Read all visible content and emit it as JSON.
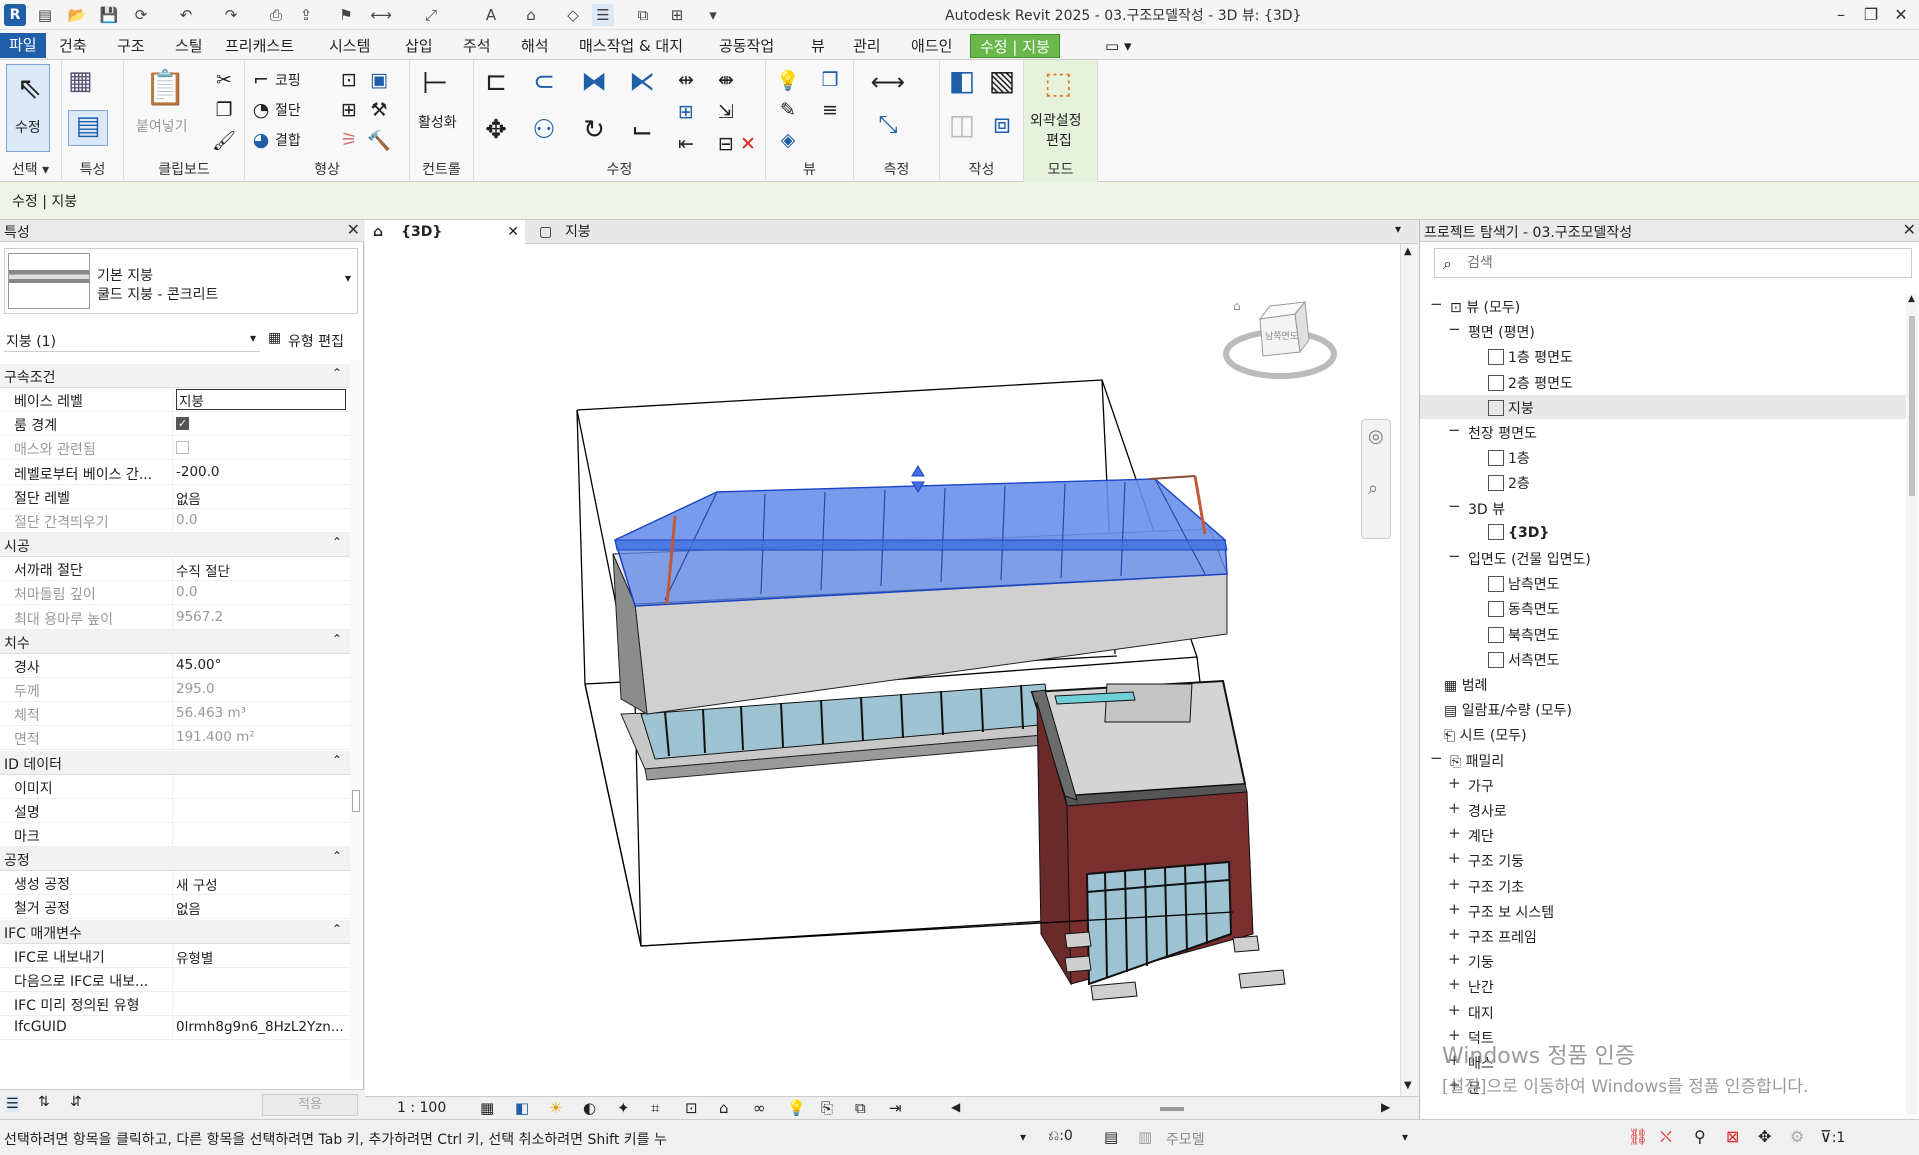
{
  "window": {
    "title": "Autodesk Revit 2025 - 03.구조모델작성 - 3D 뷰: {3D}",
    "app_badge": "R"
  },
  "menu": {
    "tabs": [
      "파일",
      "건축",
      "구조",
      "스틸",
      "프리캐스트",
      "시스템",
      "삽입",
      "주석",
      "해석",
      "매스작업 & 대지",
      "공동작업",
      "뷰",
      "관리",
      "애드인",
      "수정 | 지붕"
    ],
    "active_tab": "수정 | 지붕"
  },
  "ribbon": {
    "modify_label": "수정",
    "select_label": "선택",
    "properties_label": "특성",
    "paste_label": "붙여넣기",
    "clipboard_label": "클립보드",
    "cope_label": "코핑",
    "cut_label": "절단",
    "join_label": "결합",
    "geometry_label": "형상",
    "activate_label": "활성화",
    "controls_label": "컨트롤",
    "modify_panel_label": "수정",
    "view_label": "뷰",
    "measure_label": "측정",
    "create_label": "작성",
    "edit_footprint_line1": "외곽설정",
    "edit_footprint_line2": "편집",
    "mode_label": "모드"
  },
  "context_bar": {
    "text": "수정 | 지붕"
  },
  "properties": {
    "title": "특성",
    "type_line1": "기본 지붕",
    "type_line2": "쿨드 지붕 - 콘크리트",
    "filter": "지붕 (1)",
    "edit_type": "유형 편집",
    "apply": "적용",
    "groups": [
      {
        "name": "구속조건",
        "rows": [
          {
            "k": "베이스 레벨",
            "v": "지붕",
            "gray": false
          },
          {
            "k": "룸 경계",
            "v": "",
            "gray": false,
            "checkbox": true,
            "checked": true
          },
          {
            "k": "매스와 관련됨",
            "v": "",
            "gray": true,
            "checkbox": true,
            "checked": false
          },
          {
            "k": "레벨로부터 베이스 간...",
            "v": "-200.0",
            "gray": false
          },
          {
            "k": "절단 레벨",
            "v": "없음",
            "gray": false
          },
          {
            "k": "절단 간격띄우기",
            "v": "0.0",
            "gray": true
          }
        ]
      },
      {
        "name": "시공",
        "rows": [
          {
            "k": "서까래 절단",
            "v": "수직 절단",
            "gray": false
          },
          {
            "k": "처마돌림 깊이",
            "v": "0.0",
            "gray": true
          },
          {
            "k": "최대 용마루 높이",
            "v": "9567.2",
            "gray": true
          }
        ]
      },
      {
        "name": "치수",
        "rows": [
          {
            "k": "경사",
            "v": "45.00°",
            "gray": false
          },
          {
            "k": "두께",
            "v": "295.0",
            "gray": true
          },
          {
            "k": "체적",
            "v": "56.463 m³",
            "gray": true
          },
          {
            "k": "면적",
            "v": "191.400 m²",
            "gray": true
          }
        ]
      },
      {
        "name": "ID 데이터",
        "rows": [
          {
            "k": "이미지",
            "v": "",
            "gray": false
          },
          {
            "k": "설명",
            "v": "",
            "gray": false
          },
          {
            "k": "마크",
            "v": "",
            "gray": false
          }
        ]
      },
      {
        "name": "공정",
        "rows": [
          {
            "k": "생성 공정",
            "v": "새 구성",
            "gray": false
          },
          {
            "k": "철거 공정",
            "v": "없음",
            "gray": false
          }
        ]
      },
      {
        "name": "IFC 매개변수",
        "rows": [
          {
            "k": "IFC로 내보내기",
            "v": "유형별",
            "gray": false
          },
          {
            "k": "다음으로 IFC로 내보...",
            "v": "",
            "gray": false
          },
          {
            "k": "IFC 미리 정의된 유형",
            "v": "",
            "gray": false
          },
          {
            "k": "IfcGUID",
            "v": "0lrmh8g9n6_8HzL2Yzn...",
            "gray": false
          }
        ]
      }
    ]
  },
  "view_tabs": [
    {
      "label": "{3D}",
      "active": true
    },
    {
      "label": "지붕",
      "active": false
    }
  ],
  "viewcube": {
    "face": "남쪽면도"
  },
  "view_bar": {
    "scale": "1 : 100"
  },
  "browser": {
    "title": "프로젝트 탐색기 - 03.구조모델작성",
    "search_placeholder": "검색",
    "items": [
      {
        "label": "뷰 (모두)",
        "level": 0,
        "pm": "−"
      },
      {
        "label": "평면 (평면)",
        "level": 1,
        "pm": "−"
      },
      {
        "label": "1층 평면도",
        "level": 2,
        "box": true
      },
      {
        "label": "2층 평면도",
        "level": 2,
        "box": true
      },
      {
        "label": "지붕",
        "level": 2,
        "box": true,
        "selected": true
      },
      {
        "label": "천장 평면도",
        "level": 1,
        "pm": "−"
      },
      {
        "label": "1층",
        "level": 2,
        "box": true
      },
      {
        "label": "2층",
        "level": 2,
        "box": true
      },
      {
        "label": "3D 뷰",
        "level": 1,
        "pm": "−"
      },
      {
        "label": "{3D}",
        "level": 2,
        "box": true,
        "bold": true
      },
      {
        "label": "입면도 (건물 입면도)",
        "level": 1,
        "pm": "−"
      },
      {
        "label": "남측면도",
        "level": 2,
        "box": true
      },
      {
        "label": "동측면도",
        "level": 2,
        "box": true
      },
      {
        "label": "북측면도",
        "level": 2,
        "box": true
      },
      {
        "label": "서측면도",
        "level": 2,
        "box": true
      },
      {
        "label": "범례",
        "level": 0
      },
      {
        "label": "일람표/수량 (모두)",
        "level": 0
      },
      {
        "label": "시트 (모두)",
        "level": 0
      },
      {
        "label": "패밀리",
        "level": 0,
        "pm": "−"
      },
      {
        "label": "가구",
        "level": 1,
        "pm": "+"
      },
      {
        "label": "경사로",
        "level": 1,
        "pm": "+"
      },
      {
        "label": "계단",
        "level": 1,
        "pm": "+"
      },
      {
        "label": "구조 기둥",
        "level": 1,
        "pm": "+"
      },
      {
        "label": "구조 기초",
        "level": 1,
        "pm": "+"
      },
      {
        "label": "구조 보 시스템",
        "level": 1,
        "pm": "+"
      },
      {
        "label": "구조 프레임",
        "level": 1,
        "pm": "+"
      },
      {
        "label": "기둥",
        "level": 1,
        "pm": "+"
      },
      {
        "label": "난간",
        "level": 1,
        "pm": "+"
      },
      {
        "label": "대지",
        "level": 1,
        "pm": "+"
      },
      {
        "label": "덕트",
        "level": 1,
        "pm": "+"
      },
      {
        "label": "매스",
        "level": 1,
        "pm": "+"
      },
      {
        "label": "문",
        "level": 1,
        "pm": "+"
      }
    ]
  },
  "watermark": {
    "line1": "Windows 정품 인증",
    "line2": "[설정]으로 이동하여 Windows를 정품 인증합니다."
  },
  "status": {
    "message": "선택하려면 항목을 클릭하고, 다른 항목을 선택하려면 Tab 키, 추가하려면 Ctrl 키, 선택 취소하려면 Shift 키를 누",
    "count": ":0",
    "model": "주모델",
    "filter_count": ":1"
  },
  "colors": {
    "file_tab": "#1f5ea8",
    "context_tab": "#6ab74b",
    "roof_glass": "#5b86e8",
    "wall": "#d8d8d8",
    "brick": "#6b2a2a"
  }
}
